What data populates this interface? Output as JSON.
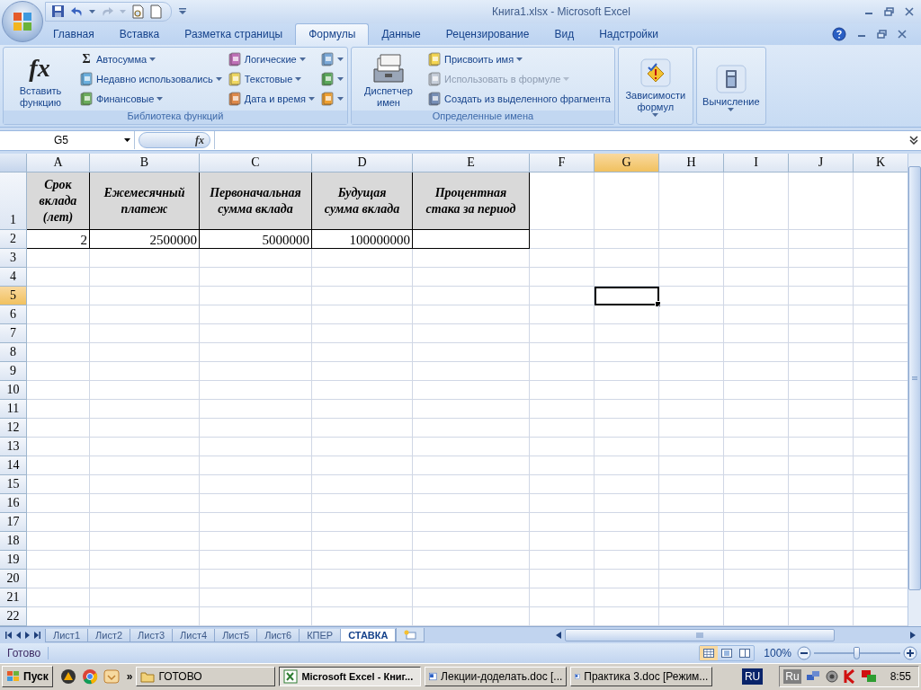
{
  "window": {
    "title": "Книга1.xlsx - Microsoft Excel"
  },
  "ribbon_tabs": [
    {
      "label": "Главная",
      "selected": false
    },
    {
      "label": "Вставка",
      "selected": false
    },
    {
      "label": "Разметка страницы",
      "selected": false
    },
    {
      "label": "Формулы",
      "selected": true
    },
    {
      "label": "Данные",
      "selected": false
    },
    {
      "label": "Рецензирование",
      "selected": false
    },
    {
      "label": "Вид",
      "selected": false
    },
    {
      "label": "Надстройки",
      "selected": false
    }
  ],
  "ribbon_groups": [
    {
      "title": "Библиотека функций",
      "columns": [
        [
          {
            "kind": "large",
            "label": "Вставить функцию",
            "glyph": "fx",
            "dropdown": false,
            "disabled": false
          }
        ],
        [
          {
            "kind": "small",
            "label": "Автосумма",
            "glyph": "Σ",
            "dropdown": true,
            "disabled": false
          },
          {
            "kind": "small",
            "label": "Недавно использовались",
            "dropdown": true,
            "disabled": false
          },
          {
            "kind": "small",
            "label": "Финансовые",
            "dropdown": true,
            "disabled": false
          }
        ],
        [
          {
            "kind": "small",
            "label": "Логические",
            "dropdown": true,
            "disabled": false
          },
          {
            "kind": "small",
            "label": "Текстовые",
            "dropdown": true,
            "disabled": false
          },
          {
            "kind": "small",
            "label": "Дата и время",
            "dropdown": true,
            "disabled": false
          }
        ],
        [
          {
            "kind": "icon",
            "dropdown": true,
            "disabled": false
          },
          {
            "kind": "icon",
            "dropdown": true,
            "disabled": false
          },
          {
            "kind": "icon",
            "dropdown": true,
            "disabled": false
          }
        ]
      ]
    },
    {
      "title": "Определенные имена",
      "columns": [
        [
          {
            "kind": "large",
            "label": "Диспетчер имен",
            "dropdown": false,
            "disabled": false
          }
        ],
        [
          {
            "kind": "small",
            "label": "Присвоить имя",
            "dropdown": true,
            "disabled": false
          },
          {
            "kind": "small",
            "label": "Использовать в формуле",
            "dropdown": true,
            "disabled": true
          },
          {
            "kind": "small",
            "label": "Создать из выделенного фрагмента",
            "dropdown": false,
            "disabled": false
          }
        ]
      ]
    },
    {
      "columns": [
        [
          {
            "kind": "large",
            "label": "Зависимости формул",
            "dropdown": true,
            "disabled": false
          }
        ]
      ]
    },
    {
      "columns": [
        [
          {
            "kind": "large",
            "label": "Вычисление",
            "dropdown": true,
            "disabled": false
          }
        ]
      ]
    }
  ],
  "formula_bar": {
    "name_box": "G5",
    "fx_label": "fx"
  },
  "sheet": {
    "columns": [
      {
        "label": "A",
        "selected": false
      },
      {
        "label": "B",
        "selected": false
      },
      {
        "label": "C",
        "selected": false
      },
      {
        "label": "D",
        "selected": false
      },
      {
        "label": "E",
        "selected": false
      },
      {
        "label": "F",
        "selected": false
      },
      {
        "label": "G",
        "selected": true
      },
      {
        "label": "H",
        "selected": false
      },
      {
        "label": "I",
        "selected": false
      },
      {
        "label": "J",
        "selected": false
      },
      {
        "label": "K",
        "selected": false
      }
    ],
    "rows": [
      {
        "label": "1",
        "selected": false
      },
      {
        "label": "2",
        "selected": false
      },
      {
        "label": "3",
        "selected": false
      },
      {
        "label": "4",
        "selected": false
      },
      {
        "label": "5",
        "selected": true
      },
      {
        "label": "6",
        "selected": false
      },
      {
        "label": "7",
        "selected": false
      },
      {
        "label": "8",
        "selected": false
      },
      {
        "label": "9",
        "selected": false
      },
      {
        "label": "10",
        "selected": false
      },
      {
        "label": "11",
        "selected": false
      },
      {
        "label": "12",
        "selected": false
      },
      {
        "label": "13",
        "selected": false
      },
      {
        "label": "14",
        "selected": false
      },
      {
        "label": "15",
        "selected": false
      },
      {
        "label": "16",
        "selected": false
      },
      {
        "label": "17",
        "selected": false
      },
      {
        "label": "18",
        "selected": false
      },
      {
        "label": "19",
        "selected": false
      },
      {
        "label": "20",
        "selected": false
      },
      {
        "label": "21",
        "selected": false
      },
      {
        "label": "22",
        "selected": false
      }
    ],
    "table": {
      "header_row": [
        "Срок вклада (лет)",
        "Ежемесячный платеж",
        "Первоначальная сумма вклада",
        "Будущая сумма вклада",
        "Процентная стака за период"
      ],
      "value_row": [
        "2",
        "2500000",
        "5000000",
        "100000000"
      ]
    }
  },
  "sheet_tabs": [
    {
      "label": "Лист1",
      "selected": false
    },
    {
      "label": "Лист2",
      "selected": false
    },
    {
      "label": "Лист3",
      "selected": false
    },
    {
      "label": "Лист4",
      "selected": false
    },
    {
      "label": "Лист5",
      "selected": false
    },
    {
      "label": "Лист6",
      "selected": false
    },
    {
      "label": "КПЕР",
      "selected": false
    },
    {
      "label": "СТАВКА",
      "selected": true
    }
  ],
  "status_bar": {
    "status": "Готово",
    "view_buttons": [
      {
        "selected": true
      },
      {
        "selected": false
      },
      {
        "selected": false
      }
    ],
    "zoom": "100%",
    "zoom_slider": {
      "level": 0.5
    }
  },
  "taskbar": {
    "start": "Пуск",
    "more": "»",
    "buttons": [
      {
        "label": "ГОТОВО",
        "selected": false
      },
      {
        "label": "Microsoft Excel - Книг...",
        "selected": true
      },
      {
        "label": "Лекции-доделать.doc [...",
        "selected": false
      },
      {
        "label": "Практика 3.doc [Режим...",
        "selected": false
      }
    ],
    "language": "RU",
    "tray_language": "Ru",
    "clock": "8:55"
  }
}
